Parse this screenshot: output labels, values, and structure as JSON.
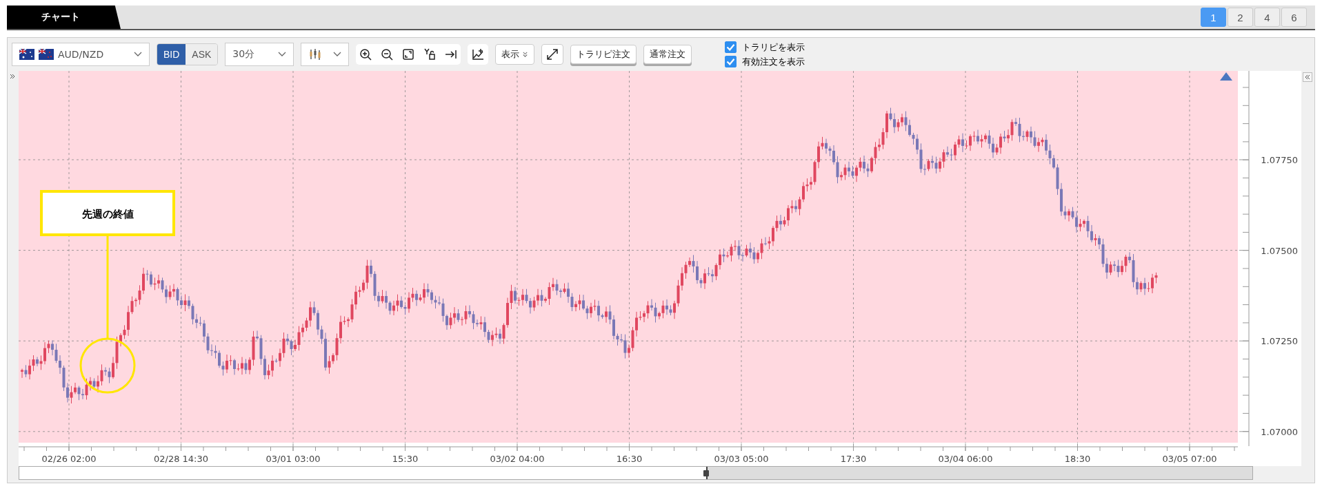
{
  "tab_bar": {
    "title": "チャート",
    "layouts": [
      {
        "label": "1",
        "selected": true
      },
      {
        "label": "2",
        "selected": false
      },
      {
        "label": "4",
        "selected": false
      },
      {
        "label": "6",
        "selected": false
      }
    ]
  },
  "toolbar": {
    "pair": "AUD/NZD",
    "price_sides": [
      {
        "label": "BID",
        "selected": true
      },
      {
        "label": "ASK",
        "selected": false
      }
    ],
    "timeframe": "30分",
    "display_button": "表示",
    "order_buttons": [
      "トラリピ注文",
      "通常注文"
    ],
    "options": [
      {
        "label": "トラリピを表示",
        "checked": true
      },
      {
        "label": "有効注文を表示",
        "checked": true
      }
    ]
  },
  "chart": {
    "annotation": "先週の終値",
    "y_axis": [
      "1.07750",
      "1.07500",
      "1.07250",
      "1.07000"
    ],
    "x_axis": [
      "02/26 02:00",
      "02/28 14:30",
      "03/01 03:00",
      "15:30",
      "03/02 04:00",
      "16:30",
      "03/03 05:00",
      "17:30",
      "03/04 06:00",
      "18:30",
      "03/05 07:00"
    ]
  }
}
